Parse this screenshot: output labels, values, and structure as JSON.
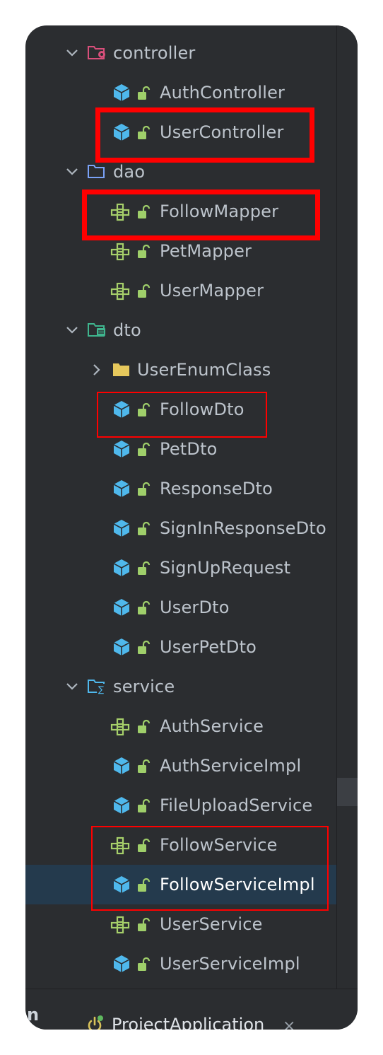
{
  "tree": {
    "rows": [
      {
        "label": "controller",
        "kind": "folder-controller",
        "expanded": true
      },
      {
        "label": "AuthController",
        "kind": "class"
      },
      {
        "label": "UserController",
        "kind": "class"
      },
      {
        "label": "dao",
        "kind": "folder",
        "expanded": true
      },
      {
        "label": "FollowMapper",
        "kind": "interface"
      },
      {
        "label": "PetMapper",
        "kind": "interface"
      },
      {
        "label": "UserMapper",
        "kind": "interface"
      },
      {
        "label": "dto",
        "kind": "folder-dto",
        "expanded": true
      },
      {
        "label": "UserEnumClass",
        "kind": "package-folder",
        "expanded": false
      },
      {
        "label": "FollowDto",
        "kind": "class"
      },
      {
        "label": "PetDto",
        "kind": "class"
      },
      {
        "label": "ResponseDto",
        "kind": "class"
      },
      {
        "label": "SignInResponseDto",
        "kind": "class"
      },
      {
        "label": "SignUpRequest",
        "kind": "class"
      },
      {
        "label": "UserDto",
        "kind": "class"
      },
      {
        "label": "UserPetDto",
        "kind": "class"
      },
      {
        "label": "service",
        "kind": "folder-service",
        "expanded": true
      },
      {
        "label": "AuthService",
        "kind": "interface"
      },
      {
        "label": "AuthServiceImpl",
        "kind": "class"
      },
      {
        "label": "FileUploadService",
        "kind": "class"
      },
      {
        "label": "FollowService",
        "kind": "interface"
      },
      {
        "label": "FollowServiceImpl",
        "kind": "class",
        "selected": true
      },
      {
        "label": "UserService",
        "kind": "interface"
      },
      {
        "label": "UserServiceImpl",
        "kind": "class"
      }
    ]
  },
  "bottom_bar": {
    "left_stub": "n",
    "tab_label": "ProjectApplication",
    "close_glyph": "×"
  },
  "colors": {
    "panel_bg": "#2b2d30",
    "selected_row_bg": "#243a4d",
    "class_icon": "#4fb8ec",
    "interface_icon": "#a6cf6a",
    "lock_icon": "#9fcf6a",
    "highlight_box": "#ff0000"
  }
}
